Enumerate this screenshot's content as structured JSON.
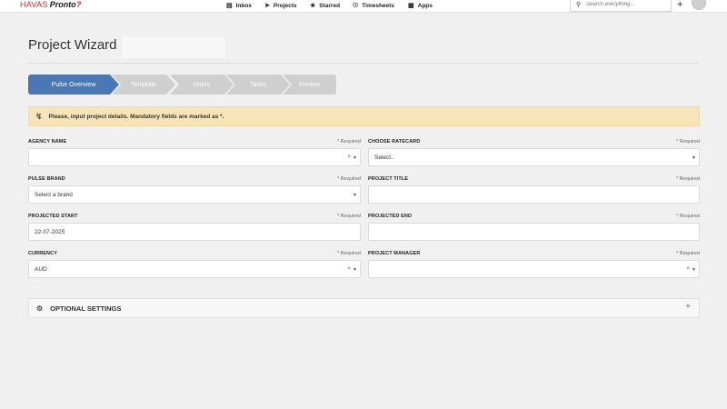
{
  "brand": {
    "logo_part1": "HAVAS",
    "logo_part2": "Pronto",
    "logo_mark": "?"
  },
  "nav": {
    "inbox": "Inbox",
    "projects": "Projects",
    "starred": "Starred",
    "timesheets": "Timesheets",
    "apps": "Apps"
  },
  "search": {
    "placeholder": "Search everything..."
  },
  "page": {
    "title": "Project Wizard"
  },
  "steps": [
    {
      "label": "Pulse Overview",
      "active": true
    },
    {
      "label": "Template",
      "active": false
    },
    {
      "label": "Users",
      "active": false
    },
    {
      "label": "Tasks",
      "active": false
    },
    {
      "label": "Review",
      "active": false
    }
  ],
  "alert": {
    "message": "Please, input project details. Mandatory fields are marked as *."
  },
  "required_label": "* Required",
  "form": {
    "agency_name": {
      "label": "AGENCY NAME",
      "value": ""
    },
    "choose_ratecard": {
      "label": "CHOOSE RATECARD",
      "value": "Select.."
    },
    "pulse_brand": {
      "label": "PULSE BRAND",
      "value": "Select a brand"
    },
    "project_title": {
      "label": "PROJECT TITLE",
      "value": ""
    },
    "projected_start": {
      "label": "PROJECTED START",
      "value": "22-07-2025"
    },
    "projected_end": {
      "label": "PROJECTED END",
      "value": ""
    },
    "currency": {
      "label": "CURRENCY",
      "value": "AUD"
    },
    "project_manager": {
      "label": "PROJECT MANAGER",
      "value": ""
    }
  },
  "optional_settings": {
    "label": "OPTIONAL SETTINGS"
  },
  "colors": {
    "step_active": "#4a78b5",
    "step_inactive": "#cfcfcf",
    "alert_bg": "#f7e5b7",
    "brand_red": "#d8242c"
  }
}
